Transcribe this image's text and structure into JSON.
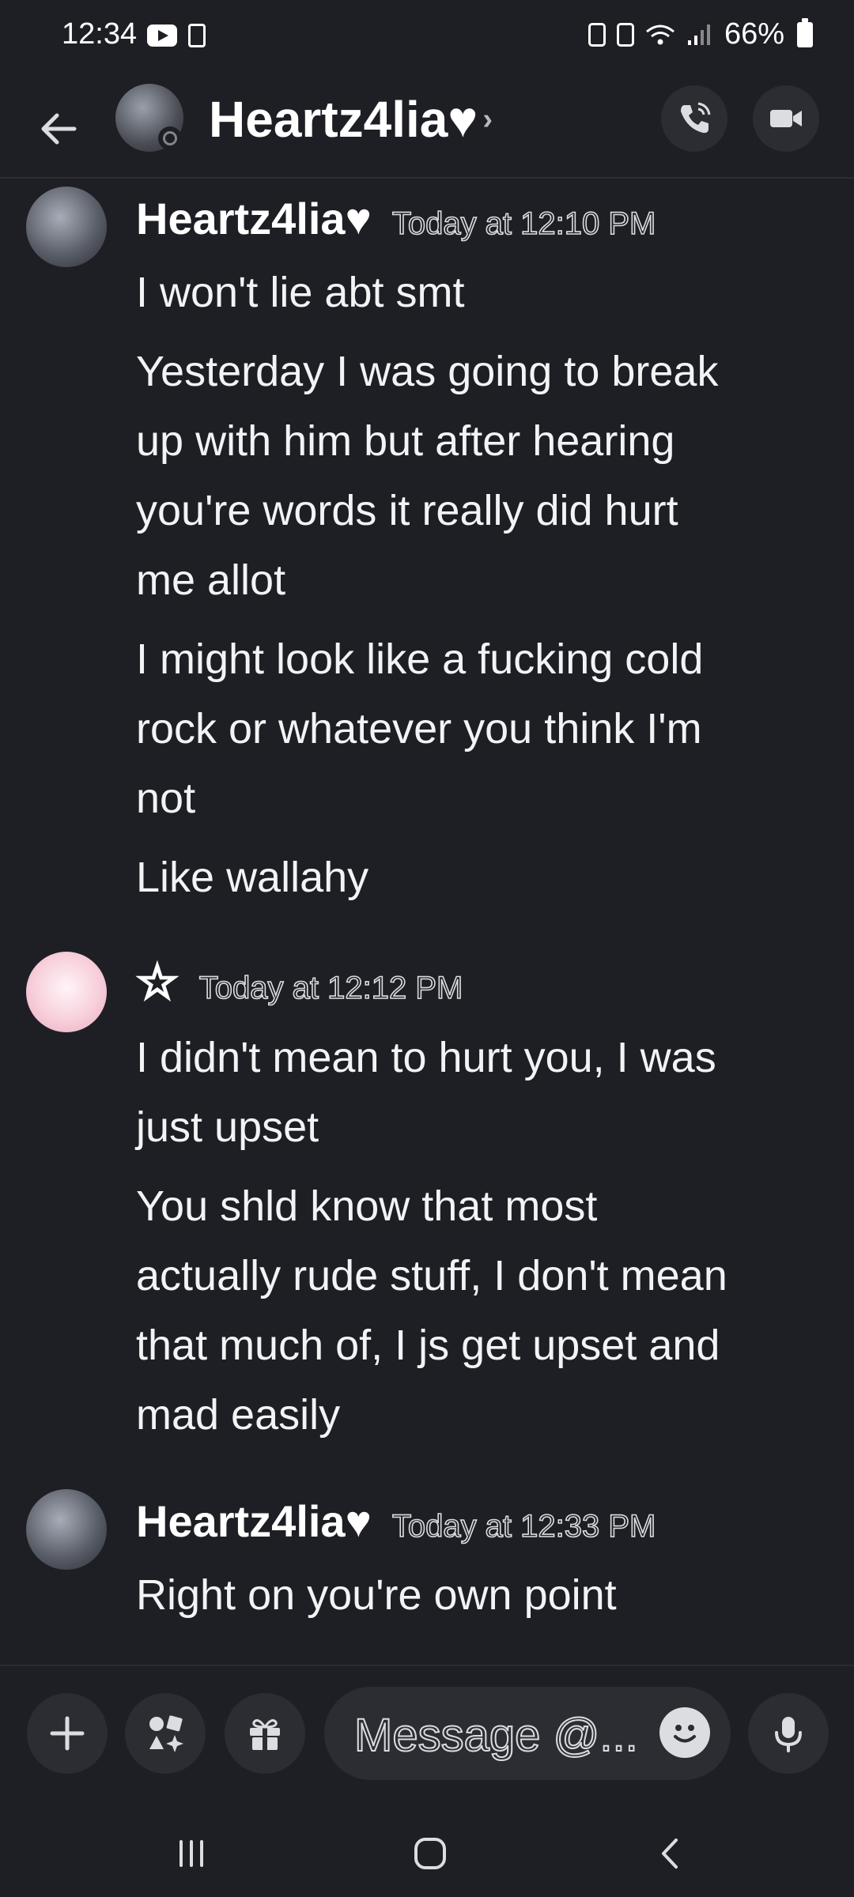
{
  "status_bar": {
    "time": "12:34",
    "battery": "66%"
  },
  "header": {
    "title": "Heartz4lia♥",
    "chevron": "›"
  },
  "messages": [
    {
      "author": "Heartz4lia♥",
      "timestamp": "Today at 12:10 PM",
      "lines": [
        "I won't lie abt smt",
        "Yesterday I was going to break",
        "up with him but after hearing",
        "you're words it really did hurt",
        "me allot",
        "I might look like a fucking cold",
        "rock or whatever you think I'm",
        "not",
        "Like wallahy"
      ]
    },
    {
      "author": "☆",
      "timestamp": "Today at 12:12 PM",
      "lines": [
        "I didn't mean to hurt you, I was",
        "just upset",
        "You shld know that most",
        "actually rude stuff, I don't mean",
        "that much of, I js get upset and",
        "mad easily"
      ]
    },
    {
      "author": "Heartz4lia♥",
      "timestamp": "Today at 12:33 PM",
      "lines": [
        "Right on you're own point"
      ]
    }
  ],
  "composer": {
    "placeholder": "Message @..."
  },
  "colors": {
    "background": "#1e1f24",
    "surface": "#2b2d33",
    "text": "#f2f3f5"
  }
}
